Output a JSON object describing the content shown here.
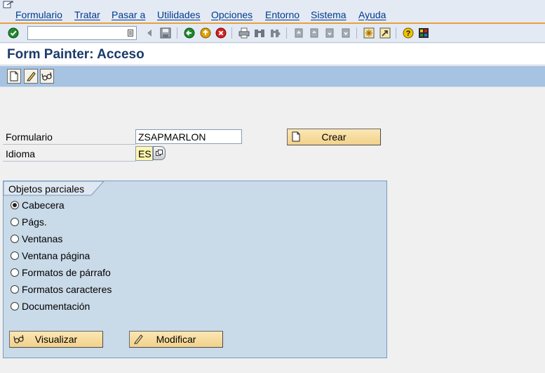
{
  "menubar": {
    "items": [
      "Formulario",
      "Tratar",
      "Pasar a",
      "Utilidades",
      "Opciones",
      "Entorno",
      "Sistema",
      "Ayuda"
    ]
  },
  "toolbar": {
    "command_field_value": ""
  },
  "page": {
    "title": "Form Painter: Acceso"
  },
  "form": {
    "form_label": "Formulario",
    "form_value": "ZSAPMARLON",
    "language_label": "Idioma",
    "language_value": "ES",
    "create_button": "Crear"
  },
  "subobjects": {
    "title": "Objetos parciales",
    "options": [
      "Cabecera",
      "Págs.",
      "Ventanas",
      "Ventana página",
      "Formatos de párrafo",
      "Formatos caracteres",
      "Documentación"
    ],
    "selected": "Cabecera",
    "display_button": "Visualizar",
    "change_button": "Modificar"
  },
  "colors": {
    "menu_bg": "#e4eaf4",
    "accent_line": "#e8a13a",
    "app_toolbar_bg": "#a7c3e2",
    "group_bg": "#c9dae9",
    "title_color": "#1c3a6b",
    "required_field": "#fff7b0"
  }
}
